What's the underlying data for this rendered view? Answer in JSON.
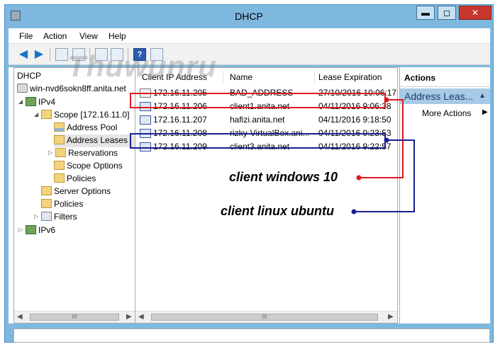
{
  "window": {
    "title": "DHCP",
    "minimize": "▬",
    "maximize": "◻",
    "close": "✕"
  },
  "menu": [
    "File",
    "Action",
    "View",
    "Help"
  ],
  "tree": {
    "root": "DHCP",
    "items": [
      {
        "label": "win-nvd6sokn8ff.anita.net",
        "icon": "server-icon"
      },
      {
        "label": "IPv4",
        "icon": "ipv4-icon"
      },
      {
        "label": "Scope [172.16.11.0]",
        "icon": "folder-icon"
      },
      {
        "label": "Address Pool",
        "icon": "address-pool-icon"
      },
      {
        "label": "Address Leases",
        "icon": "address-leases-icon"
      },
      {
        "label": "Reservations",
        "icon": "folder-icon"
      },
      {
        "label": "Scope Options",
        "icon": "folder-icon"
      },
      {
        "label": "Policies",
        "icon": "folder-icon"
      },
      {
        "label": "Server Options",
        "icon": "folder-icon"
      },
      {
        "label": "Policies",
        "icon": "folder-icon"
      },
      {
        "label": "Filters",
        "icon": "filter-icon"
      },
      {
        "label": "IPv6",
        "icon": "ipv6-icon"
      }
    ]
  },
  "list": {
    "columns": [
      "Client IP Address",
      "Name",
      "Lease Expiration"
    ],
    "rows": [
      {
        "ip": "172.16.11.205",
        "name": "BAD_ADDRESS",
        "expiration": "27/10/2016 10:06:17"
      },
      {
        "ip": "172.16.11.206",
        "name": "client1.anita.net",
        "expiration": "04/11/2016 9:06:38"
      },
      {
        "ip": "172.16.11.207",
        "name": "hafizi.anita.net",
        "expiration": "04/11/2016 9:18:50"
      },
      {
        "ip": "172.16.11.208",
        "name": "rizky-VirtualBox.ani...",
        "expiration": "04/11/2016 9:23:53"
      },
      {
        "ip": "172.16.11.209",
        "name": "client3.anita.net",
        "expiration": "04/11/2016 9:22:57"
      }
    ]
  },
  "actions": {
    "title": "Actions",
    "section": "Address Leas...",
    "more": "More Actions"
  },
  "annotations": {
    "windows": "client windows 10",
    "linux": "client linux ubuntu",
    "red": "#e0191f",
    "blue": "#1b1f8f"
  },
  "watermark": "Thuwunru",
  "scroll_thumb": "III"
}
